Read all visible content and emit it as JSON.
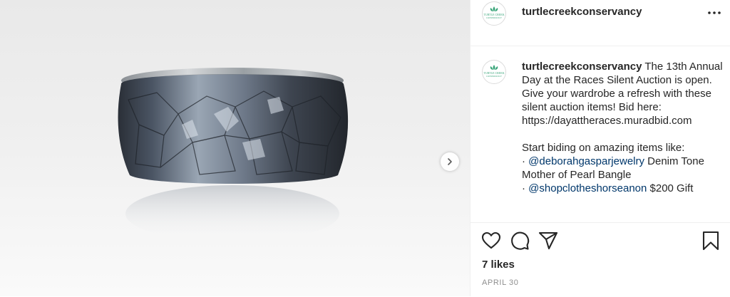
{
  "account": {
    "username": "turtlecreekconservancy",
    "avatar_logo_lines": [
      "TURTLE CREEK",
      "CONSERVANCY"
    ]
  },
  "header": {
    "more_icon": "ellipsis-horizontal-icon"
  },
  "media": {
    "subject": "mother-of-pearl bangle bracelet",
    "next_icon": "chevron-right-icon"
  },
  "caption": {
    "username": "turtlecreekconservancy",
    "text_1": " The 13th Annual Day at the Races Silent Auction is open. Give your wardrobe a refresh with these silent auction items! Bid here: https://dayattheraces.muradbid.com",
    "text_2": "Start biding on amazing items like:",
    "item_1": {
      "bullet": "· ",
      "mention": "@deborahgasparjewelry",
      "text": " Denim Tone Mother of Pearl Bangle"
    },
    "item_2": {
      "bullet": "· ",
      "mention": "@shopclotheshorseanon",
      "text": " $200 Gift"
    }
  },
  "actions": {
    "like_icon": "heart-icon",
    "comment_icon": "comment-icon",
    "share_icon": "paper-plane-icon",
    "save_icon": "bookmark-icon"
  },
  "likes_text": "7 likes",
  "date_text": "APRIL 30",
  "colors": {
    "text": "#262626",
    "mention": "#00376b",
    "secondary": "#8e8e8e",
    "divider": "#efefef",
    "logo_green": "#3aa57a"
  }
}
